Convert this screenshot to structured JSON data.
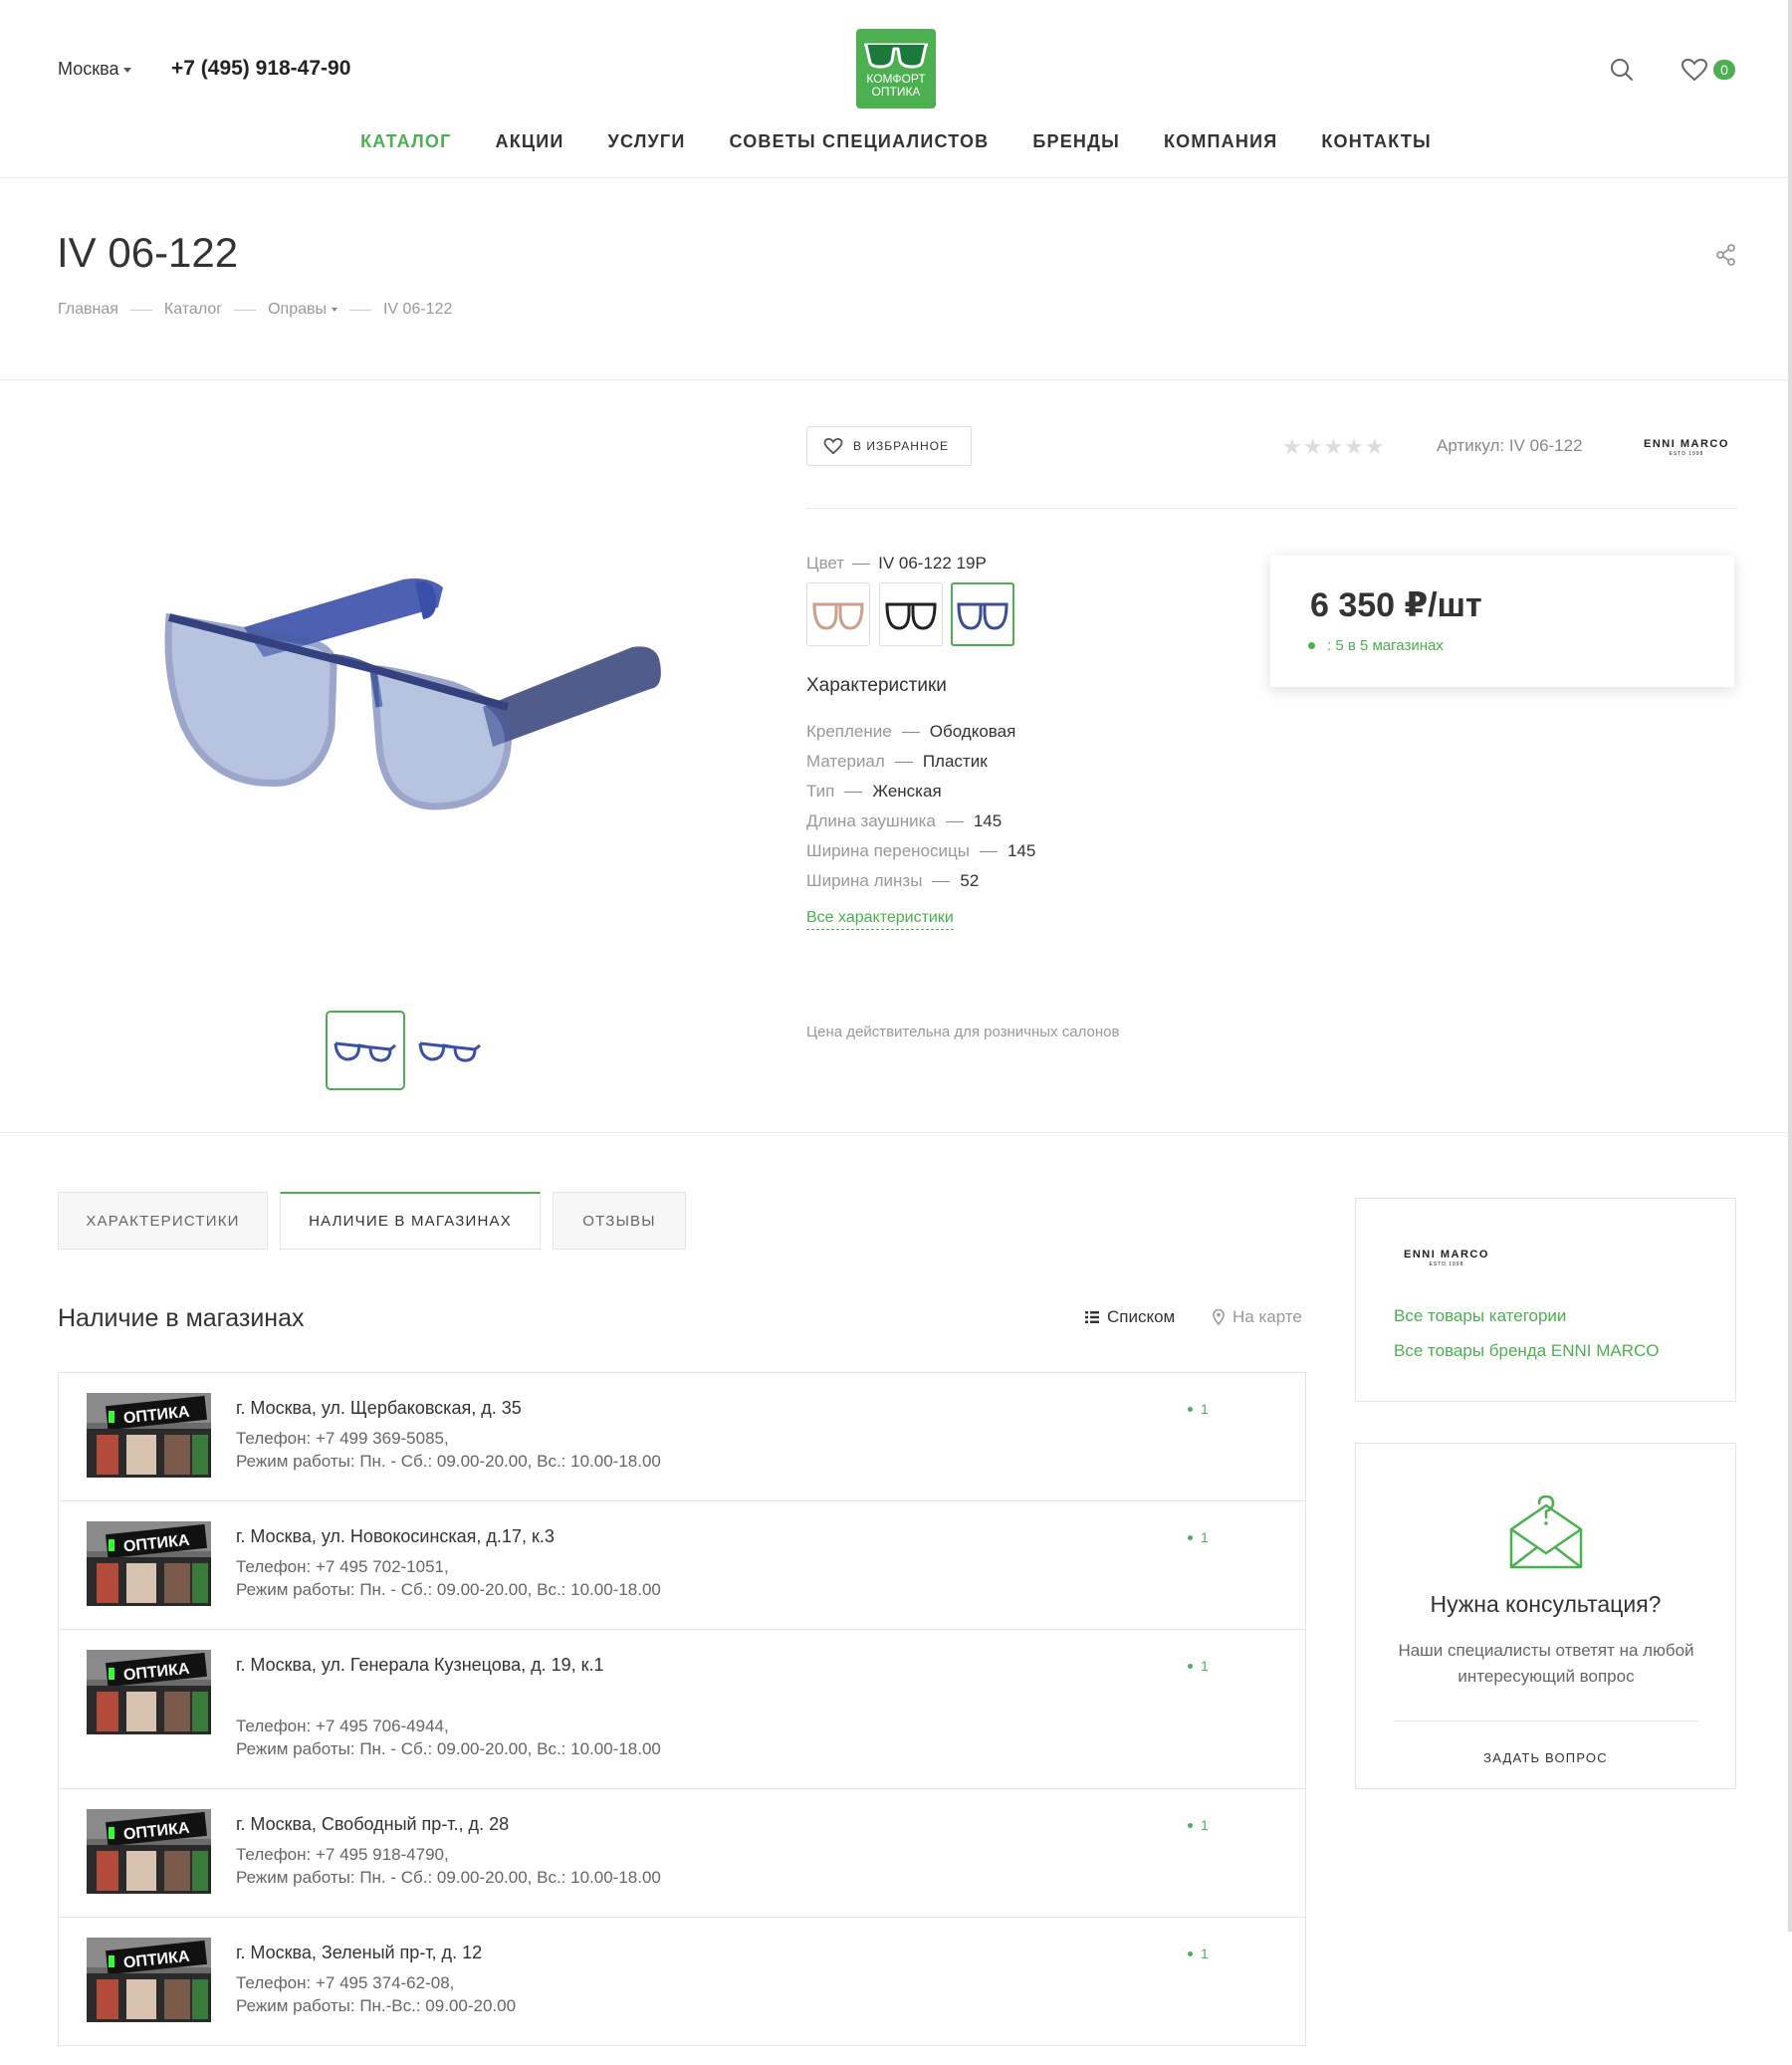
{
  "header": {
    "city": "Москва",
    "phone": "+7 (495) 918-47-90",
    "logo_line1": "КОМФОРТ",
    "logo_line2": "ОПТИКА",
    "favorites_count": "0",
    "icons": [
      "search-icon",
      "heart-icon"
    ]
  },
  "nav": [
    "КАТАЛОГ",
    "АКЦИИ",
    "УСЛУГИ",
    "СОВЕТЫ СПЕЦИАЛИСТОВ",
    "БРЕНДЫ",
    "КОМПАНИЯ",
    "КОНТАКТЫ"
  ],
  "nav_active": "КАТАЛОГ",
  "page": {
    "title": "IV 06-122",
    "breadcrumbs": [
      "Главная",
      "Каталог",
      "Оправы",
      "IV 06-122"
    ]
  },
  "product": {
    "favorite_label": "В ИЗБРАННОЕ",
    "stars": "★★★★★",
    "sku": "Артикул: IV 06-122",
    "brand": "ENNI MARCO",
    "brand_tag": "ESTD 1998",
    "color_label": "Цвет",
    "color_value": "IV 06-122 19P",
    "swatch_colors": [
      "#c9a08a",
      "#222222",
      "#3b4f8f"
    ],
    "characteristics_title": "Характеристики",
    "props": [
      {
        "k": "Крепление",
        "v": "Ободковая"
      },
      {
        "k": "Материал",
        "v": "Пластик"
      },
      {
        "k": "Тип",
        "v": "Женская"
      },
      {
        "k": "Длина заушника",
        "v": "145"
      },
      {
        "k": "Ширина переносицы",
        "v": "145"
      },
      {
        "k": "Ширина линзы",
        "v": "52"
      }
    ],
    "all_characteristics": "Все характеристики",
    "price_note": "Цена действительна для розничных салонов",
    "price": "6 350 ₽/шт",
    "availability": ": 5 в 5 магазинах",
    "accent_color": "#4caf50"
  },
  "tabs": [
    "ХАРАКТЕРИСТИКИ",
    "НАЛИЧИЕ В МАГАЗИНАХ",
    "ОТЗЫВЫ"
  ],
  "tab_active": "НАЛИЧИЕ В МАГАЗИНАХ",
  "stores_section": {
    "title": "Наличие в магазинах",
    "view_list": "Списком",
    "view_map": "На карте",
    "photo_sign": "ОПТИКА",
    "stores": [
      {
        "addr": "г. Москва, ул. Щербаковская, д. 35",
        "phone": "Телефон: +7 499 369-5085,",
        "hours": "Режим работы: Пн. - Сб.: 09.00-20.00, Вс.: 10.00-18.00",
        "count": "1"
      },
      {
        "addr": "г. Москва, ул. Новокосинская, д.17, к.3",
        "phone": "Телефон: +7 495 702-1051,",
        "hours": "Режим работы: Пн. - Сб.: 09.00-20.00, Вс.: 10.00-18.00",
        "count": "1"
      },
      {
        "addr": "г. Москва, ул. Генерала Кузнецова, д. 19, к.1",
        "phone": "Телефон: +7 495 706-4944,",
        "hours": "Режим работы: Пн. - Сб.: 09.00-20.00, Вс.: 10.00-18.00",
        "count": "1"
      },
      {
        "addr": "г. Москва, Свободный пр-т., д. 28",
        "phone": "Телефон: +7 495 918-4790,",
        "hours": "Режим работы: Пн. - Сб.: 09.00-20.00, Вс.: 10.00-18.00",
        "count": "1"
      },
      {
        "addr": "г. Москва, Зеленый пр-т, д. 12",
        "phone": "Телефон: +7 495 374-62-08,",
        "hours": "Режим работы: Пн.-Вс.: 09.00-20.00",
        "count": "1"
      }
    ]
  },
  "sidebar": {
    "brand": "ENNI MARCO",
    "brand_tag": "ESTD 1998",
    "link_category": "Все товары категории",
    "link_brand": "Все товары бренда ENNI MARCO",
    "consult_title": "Нужна консультация?",
    "consult_text": "Наши специалисты ответят на любой интересующий вопрос",
    "consult_button": "ЗАДАТЬ ВОПРОС"
  }
}
